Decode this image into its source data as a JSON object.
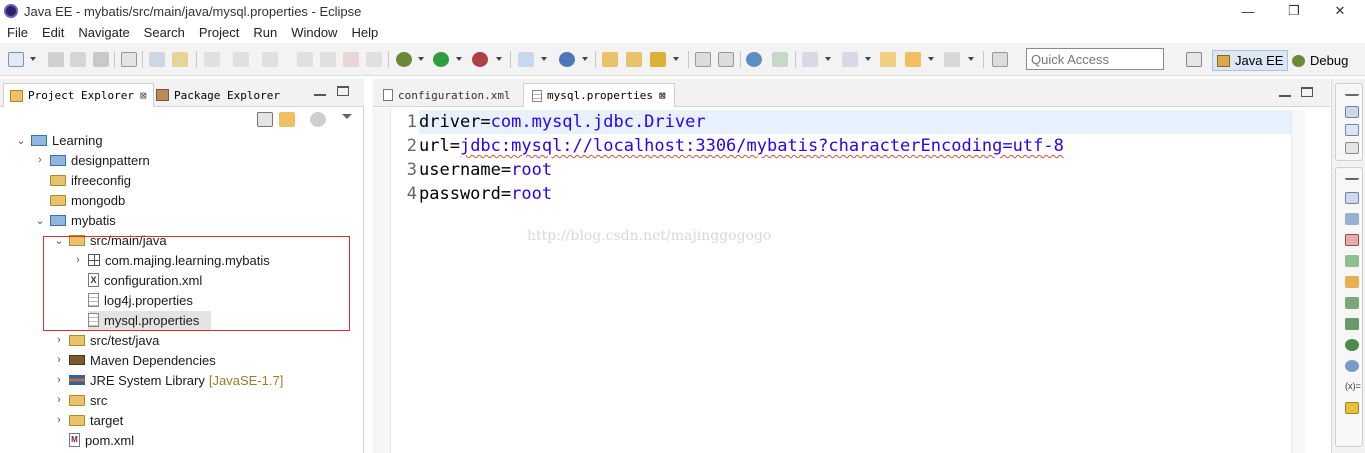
{
  "window": {
    "title": "Java EE - mybatis/src/main/java/mysql.properties - Eclipse",
    "minimize": "—",
    "maximize": "❐",
    "close": "✕"
  },
  "menu": [
    "File",
    "Edit",
    "Navigate",
    "Search",
    "Project",
    "Run",
    "Window",
    "Help"
  ],
  "toolbar": {
    "quick_access_placeholder": "Quick Access",
    "perspectives": [
      "Java EE",
      "Debug"
    ]
  },
  "left_panel": {
    "tabs": [
      {
        "label": "Project Explorer",
        "close": "⊠",
        "active": true
      },
      {
        "label": "Package Explorer",
        "active": false
      }
    ],
    "tree": [
      {
        "label": "Learning",
        "twisty": "⌄",
        "icon": "project-icon"
      },
      {
        "label": "designpattern",
        "twisty": "›",
        "icon": "project-icon"
      },
      {
        "label": "ifreeconfig",
        "twisty": "",
        "icon": "folder-icon"
      },
      {
        "label": "mongodb",
        "twisty": "",
        "icon": "folder-icon"
      },
      {
        "label": "mybatis",
        "twisty": "⌄",
        "icon": "project-icon"
      },
      {
        "label": "src/main/java",
        "twisty": "⌄",
        "icon": "source-folder-icon"
      },
      {
        "label": "com.majing.learning.mybatis",
        "twisty": "›",
        "icon": "package-icon"
      },
      {
        "label": "configuration.xml",
        "twisty": "",
        "icon": "xml-file-icon"
      },
      {
        "label": "log4j.properties",
        "twisty": "",
        "icon": "properties-file-icon"
      },
      {
        "label": "mysql.properties",
        "twisty": "",
        "icon": "properties-file-icon",
        "selected": true
      },
      {
        "label": "src/test/java",
        "twisty": "›",
        "icon": "source-folder-icon"
      },
      {
        "label": "Maven Dependencies",
        "twisty": "›",
        "icon": "library-icon"
      },
      {
        "label": "JRE System Library",
        "suffix": "[JavaSE-1.7]",
        "twisty": "›",
        "icon": "jre-library-icon"
      },
      {
        "label": "src",
        "twisty": "›",
        "icon": "folder-icon"
      },
      {
        "label": "target",
        "twisty": "›",
        "icon": "folder-icon"
      },
      {
        "label": "pom.xml",
        "twisty": "",
        "icon": "pom-file-icon"
      }
    ]
  },
  "editor": {
    "tabs": [
      {
        "label": "configuration.xml",
        "active": false
      },
      {
        "label": "mysql.properties",
        "close": "⊠",
        "active": true
      }
    ],
    "lines": [
      {
        "num": "1",
        "key": "driver=",
        "value": "com.mysql.jdbc.Driver"
      },
      {
        "num": "2",
        "key": "url=",
        "value": "jdbc:mysql://localhost:3306/mybatis?characterEncoding=utf-8"
      },
      {
        "num": "3",
        "key": "username=",
        "value": "root"
      },
      {
        "num": "4",
        "key": "password=",
        "value": "root"
      }
    ],
    "watermark": "http://blog.csdn.net/majinggogogo"
  },
  "colors": {
    "property_value": "#2a00ff",
    "selection_box": "#d9302e",
    "current_line": "#e8f2fe"
  }
}
